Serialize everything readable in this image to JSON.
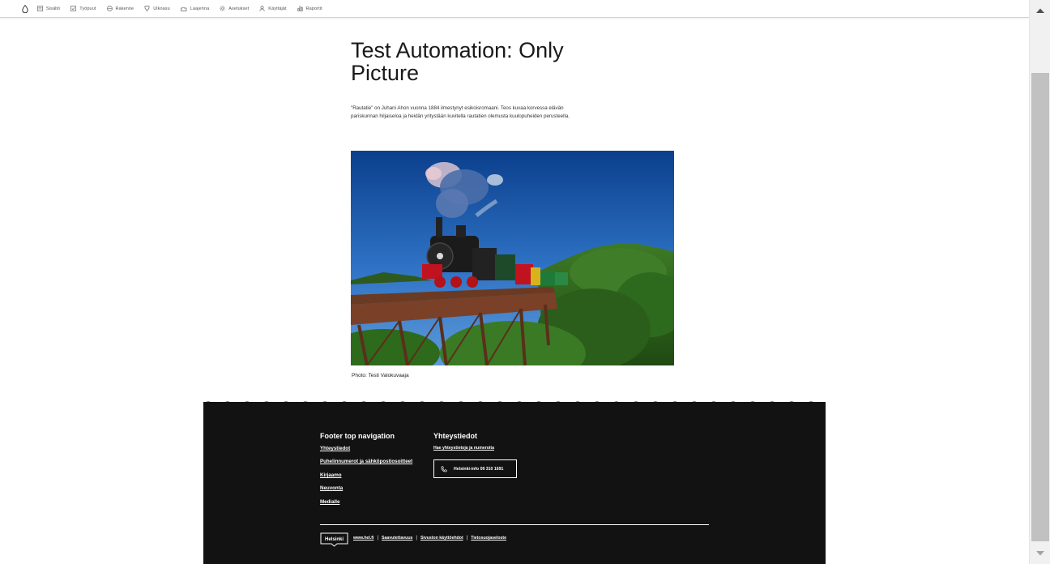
{
  "toolbar": {
    "logo_icon": "drop-icon",
    "items": [
      {
        "label": "Sisältö",
        "icon": "document-icon"
      },
      {
        "label": "Työpuut",
        "icon": "checklist-icon"
      },
      {
        "label": "Rakenne",
        "icon": "layers-icon"
      },
      {
        "label": "Ulkoasu",
        "icon": "brush-icon"
      },
      {
        "label": "Laajenna",
        "icon": "puzzle-icon"
      },
      {
        "label": "Asetukset",
        "icon": "gear-icon"
      },
      {
        "label": "Käyttäjät",
        "icon": "user-icon"
      },
      {
        "label": "Raportit",
        "icon": "bar-chart-icon"
      }
    ]
  },
  "page": {
    "title": "Test Automation: Only Picture",
    "lead": "\"Rautatie\" on Juhani Ahon vuonna 1884 ilmestynyt esikoisromaani. Teos kuvaa korvessa elävän pariskunnan hiljaiseloa ja heidän yritystään kuvitella rautatien olemusta kuulopuheiden perusteella.",
    "caption": "Photo: Testi Valokuvaaja"
  },
  "footer": {
    "nav_heading": "Footer top navigation",
    "nav_links": [
      "Yhteystiedot",
      "Puhelinnumerot ja sähköpostiosoitteet",
      "Kirjaamo",
      "Neuvonta",
      "Medialle"
    ],
    "contact_heading": "Yhteystiedot",
    "contact_link": "Hae yhteystietoja ja numeroita",
    "phone_label": "Helsinki-info 09 310 1691",
    "logo_text": "Helsinki",
    "bottom_links": [
      "www.hel.fi",
      "Saavutettavuus",
      "Sivuston käyttöehdot",
      "Tietosuojaseloste"
    ]
  },
  "colors": {
    "footer_bg": "#121212",
    "text": "#1a1a1a"
  }
}
